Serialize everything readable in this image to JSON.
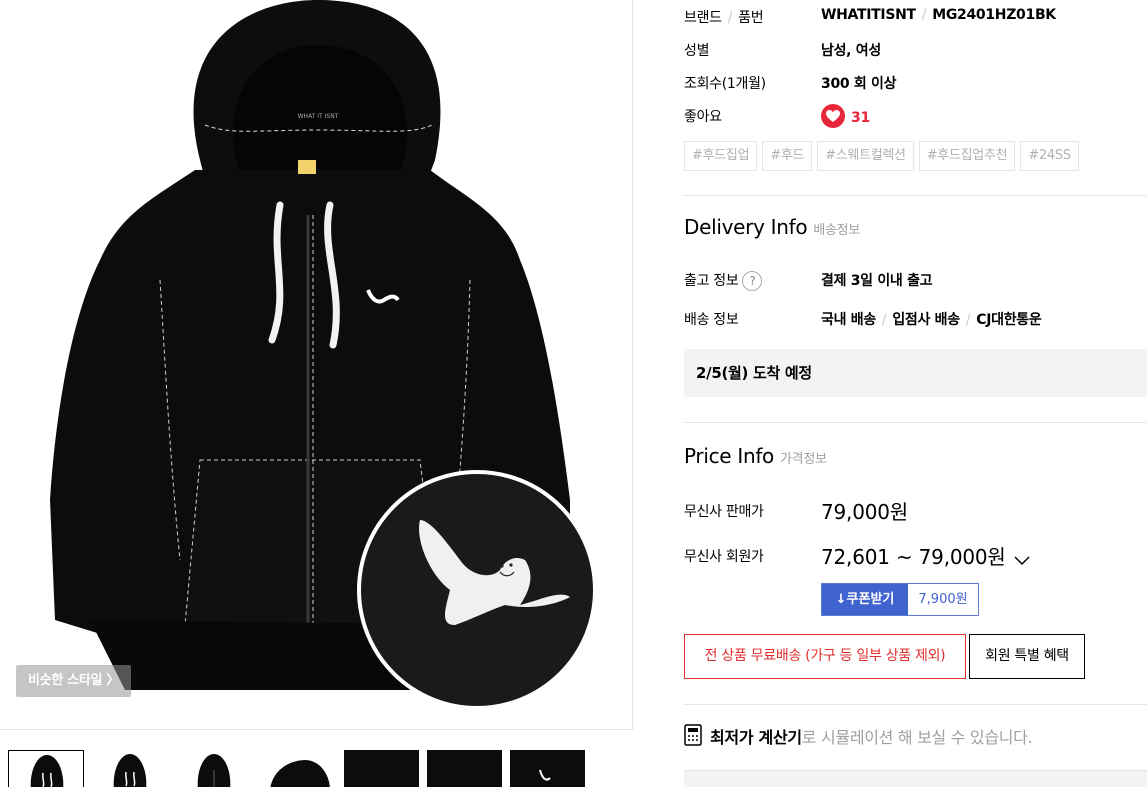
{
  "gallery": {
    "similar_style_label": "비슷한 스타일 〉"
  },
  "info": {
    "brand_label": "브랜드",
    "sku_label": "품번",
    "brand": "WHATITISNT",
    "sku": "MG2401HZ01BK",
    "gender_label": "성별",
    "gender": "남성, 여성",
    "views_label": "조회수(1개월)",
    "views": "300 회 이상",
    "likes_label": "좋아요",
    "likes": "31",
    "tags": [
      "#후드집업",
      "#후드",
      "#스웨트컬렉션",
      "#후드집업추천",
      "#24SS"
    ]
  },
  "delivery": {
    "title": "Delivery Info",
    "subtitle": "배송정보",
    "release_label": "출고 정보",
    "release_value": "결제 3일 이내 출고",
    "shipping_label": "배송 정보",
    "shipping_values": [
      "국내 배송",
      "입점사 배송",
      "CJ대한통운"
    ],
    "eta": "2/5(월) 도착 예정"
  },
  "price": {
    "title": "Price Info",
    "subtitle": "가격정보",
    "sale_label": "무신사 판매가",
    "sale_value": "79,000원",
    "member_label": "무신사 회원가",
    "member_value": "72,601 ~ 79,000원",
    "coupon_button": "쿠폰받기",
    "coupon_amount": "7,900원",
    "free_shipping": "전 상품 무료배송 (가구 등 일부 상품 제외)",
    "member_benefit": "회원 특별 혜택"
  },
  "calculator": {
    "title": "최저가 계산기",
    "desc": "로 시뮬레이션 해 보실 수 있습니다."
  },
  "colors": {
    "accent_blue": "#3f63cf",
    "like_red": "#e7263a",
    "promo_red": "#e03030"
  }
}
